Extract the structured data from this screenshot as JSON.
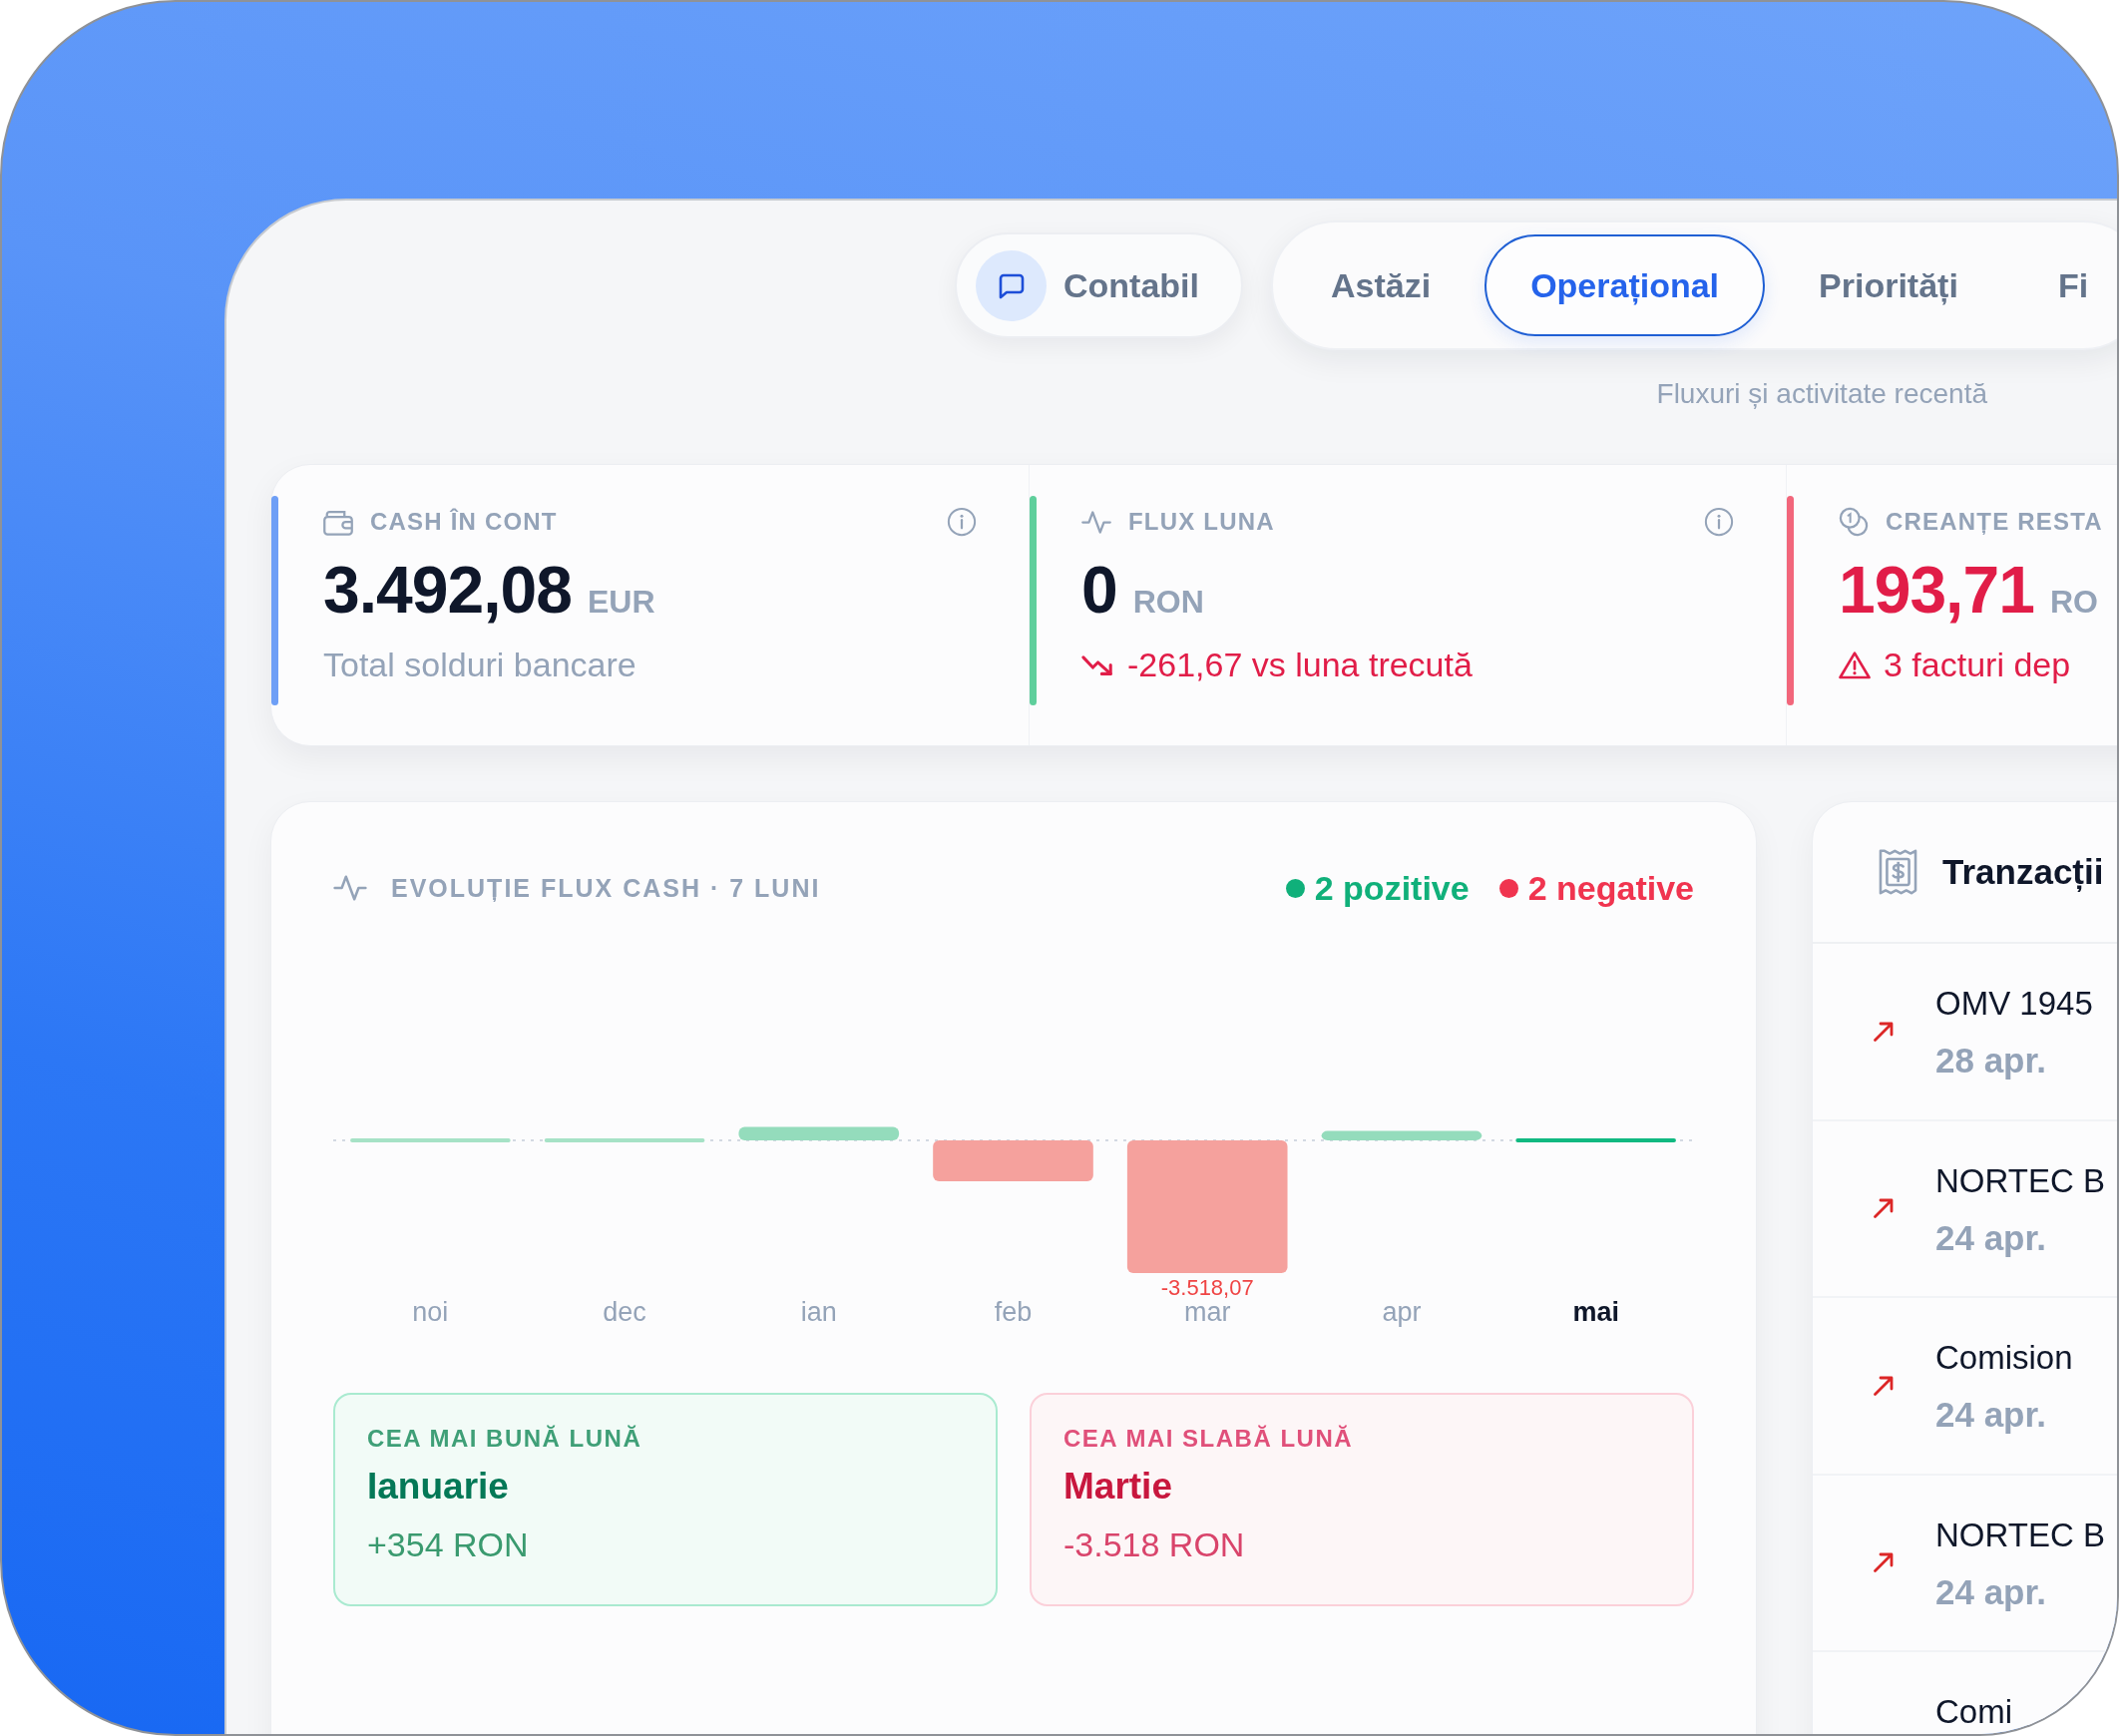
{
  "window": {
    "mode_button": {
      "label": "Contabil"
    },
    "tabs": [
      {
        "label": "Astăzi",
        "selected": false
      },
      {
        "label": "Operațional",
        "selected": true
      },
      {
        "label": "Priorități",
        "selected": false
      },
      {
        "label": "Fi",
        "selected": false
      }
    ],
    "subtitle": "Fluxuri și activitate recentă"
  },
  "kpis": [
    {
      "kind": "balance",
      "label": "CASH ÎN CONT",
      "info": true,
      "value": "3.492,08",
      "unit": "EUR",
      "alert": false,
      "note": {
        "kind": "plain",
        "text": "Total solduri bancare"
      },
      "color": "#6e9ff6"
    },
    {
      "kind": "flow",
      "label": "FLUX LUNA",
      "info": true,
      "value": "0",
      "unit": "RON",
      "alert": false,
      "note": {
        "kind": "trend_down",
        "text": "-261,67 vs luna trecută"
      },
      "color": "#5fcf9c"
    },
    {
      "kind": "receivables",
      "label": "CREANȚE RESTA",
      "info": false,
      "value": "193,71",
      "unit": "RO",
      "alert": true,
      "note": {
        "kind": "warning",
        "text": "3 facturi dep"
      },
      "color": "#f2667b"
    }
  ],
  "cash_flow": {
    "title": "EVOLUȚIE FLUX CASH · 7 LUNI",
    "legend": [
      {
        "label": "2 pozitive",
        "color": "#10b07a"
      },
      {
        "label": "2 negative",
        "color": "#f0344f"
      }
    ],
    "chart_data": {
      "type": "bar",
      "categories": [
        "noi",
        "dec",
        "ian",
        "feb",
        "mar",
        "apr",
        "mai"
      ],
      "values": [
        0,
        0,
        354,
        -1085,
        -3518.07,
        250,
        0
      ],
      "value_labels": [
        null,
        null,
        null,
        null,
        "-3.518,07",
        null,
        null
      ]
    },
    "bars": [
      {
        "selected": false
      },
      {
        "selected": false
      },
      {
        "selected": false
      },
      {
        "selected": false
      },
      {
        "selected": false
      },
      {
        "selected": false
      },
      {
        "selected": true
      }
    ],
    "extremes": [
      {
        "kind": "best",
        "label": "CEA MAI BUNĂ LUNĂ",
        "month": "Ianuarie",
        "amount": "+354 RON"
      },
      {
        "kind": "worst",
        "label": "CEA MAI SLABĂ LUNĂ",
        "month": "Martie",
        "amount": "-3.518 RON"
      }
    ]
  },
  "transactions": {
    "title": "Tranzacții",
    "rows": [
      {
        "kind": "out",
        "name": "OMV 1945",
        "date": "28 apr."
      },
      {
        "kind": "out",
        "name": "NORTEC B",
        "date": "24 apr."
      },
      {
        "kind": "out",
        "name": "Comision",
        "date": "24 apr."
      },
      {
        "kind": "out",
        "name": "NORTEC B",
        "date": "24 apr."
      },
      {
        "kind": "plain",
        "name": "Comi"
      }
    ]
  }
}
